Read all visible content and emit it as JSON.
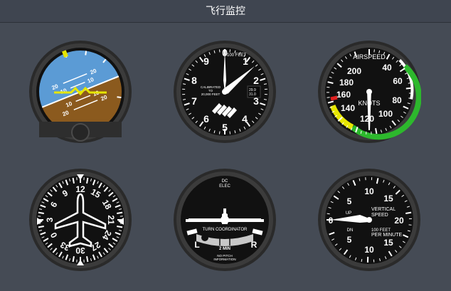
{
  "app": {
    "title": "飞行监控"
  },
  "colors": {
    "background": "#454b55",
    "bezel": "#3a3a3a",
    "face": "#1b1b1b",
    "sky": "#5b9bd5",
    "ground": "#8b5a1e",
    "green_arc": "#2db82d",
    "yellow_arc": "#e6e600",
    "red_arc": "#e02020"
  },
  "attitude": {
    "pitch_labels": [
      "20",
      "10",
      "10",
      "20",
      "20",
      "10",
      "10",
      "20"
    ],
    "bank_pointer_color": "#e6e600"
  },
  "altimeter": {
    "dial_numbers": [
      "0",
      "1",
      "2",
      "3",
      "4",
      "5",
      "6",
      "7",
      "8",
      "9"
    ],
    "label_top": "100 FEET",
    "label_left_1": "CALIBRATED",
    "label_left_2": "TO",
    "label_left_3": "20,000 FEET",
    "kollsman_1": "29.9",
    "kollsman_2": "31.0"
  },
  "airspeed": {
    "title": "AIRSPEED",
    "unit": "KNOTS",
    "scale": [
      "40",
      "60",
      "80",
      "100",
      "120",
      "140",
      "160",
      "180",
      "200"
    ]
  },
  "heading": {
    "scale": [
      "33",
      "3",
      "6",
      "9",
      "12",
      "15",
      "18",
      "21",
      "24",
      "27",
      "30",
      "0"
    ],
    "card_text": [
      "0",
      "3",
      "6",
      "9",
      "12",
      "15",
      "18",
      "21",
      "24",
      "27",
      "30",
      "33"
    ]
  },
  "turn_coordinator": {
    "label_top_1": "DC",
    "label_top_2": "ELEC",
    "title": "TURN COORDINATOR",
    "left": "L",
    "right": "R",
    "time": "2 MIN",
    "footer_1": "NO PITCH",
    "footer_2": "INFORMATION"
  },
  "vsi": {
    "scale_top": [
      "5",
      "10",
      "15",
      "20"
    ],
    "scale_bottom": [
      "5",
      "10",
      "15"
    ],
    "up": "UP",
    "down": "DN",
    "label_1": "VERTICAL",
    "label_2": "SPEED",
    "label_3": "100 FEET",
    "label_4": "PER MINUTE",
    "center": "0"
  }
}
